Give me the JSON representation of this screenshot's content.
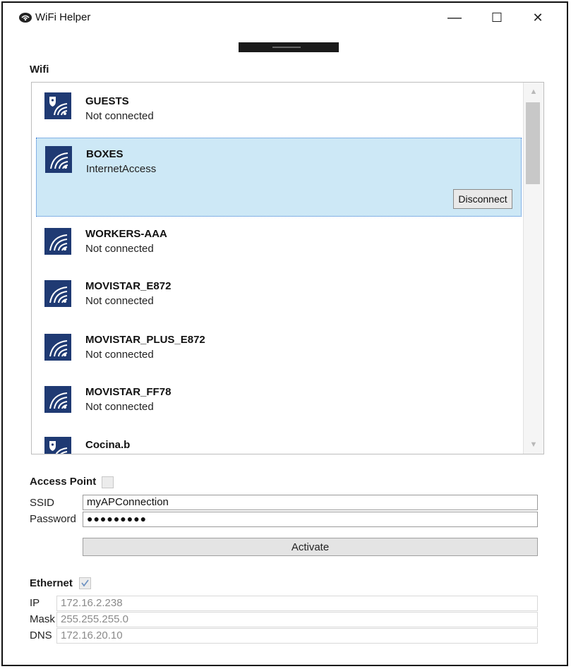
{
  "window": {
    "title": "WiFi Helper",
    "app_icon": "wifi-helper-app-icon",
    "controls": {
      "minimize": "—",
      "maximize": "☐",
      "close": "✕"
    }
  },
  "wifi": {
    "section_label": "Wifi",
    "networks": [
      {
        "name": "GUESTS",
        "status": "Not connected",
        "icon": "secured-wifi-icon"
      },
      {
        "name": "BOXES",
        "status": "InternetAccess",
        "icon": "wifi-icon",
        "selected": true,
        "action_label": "Disconnect"
      },
      {
        "name": "WORKERS-AAA",
        "status": "Not connected",
        "icon": "wifi-icon"
      },
      {
        "name": "MOVISTAR_E872",
        "status": "Not connected",
        "icon": "wifi-icon"
      },
      {
        "name": "MOVISTAR_PLUS_E872",
        "status": "Not connected",
        "icon": "wifi-icon"
      },
      {
        "name": "MOVISTAR_FF78",
        "status": "Not connected",
        "icon": "wifi-icon"
      },
      {
        "name": "Cocina.b",
        "status": "",
        "icon": "secured-wifi-icon"
      }
    ]
  },
  "access_point": {
    "section_label": "Access Point",
    "enabled": false,
    "ssid_label": "SSID",
    "ssid_value": "myAPConnection",
    "password_label": "Password",
    "password_value": "●●●●●●●●●",
    "activate_label": "Activate"
  },
  "ethernet": {
    "section_label": "Ethernet",
    "enabled": true,
    "ip_label": "IP",
    "ip_value": "172.16.2.238",
    "mask_label": "Mask",
    "mask_value": "255.255.255.0",
    "dns_label": "DNS",
    "dns_value": "172.16.20.10"
  },
  "colors": {
    "wifi_icon_bg": "#1f3a73",
    "selected_bg": "#cde8f6"
  }
}
